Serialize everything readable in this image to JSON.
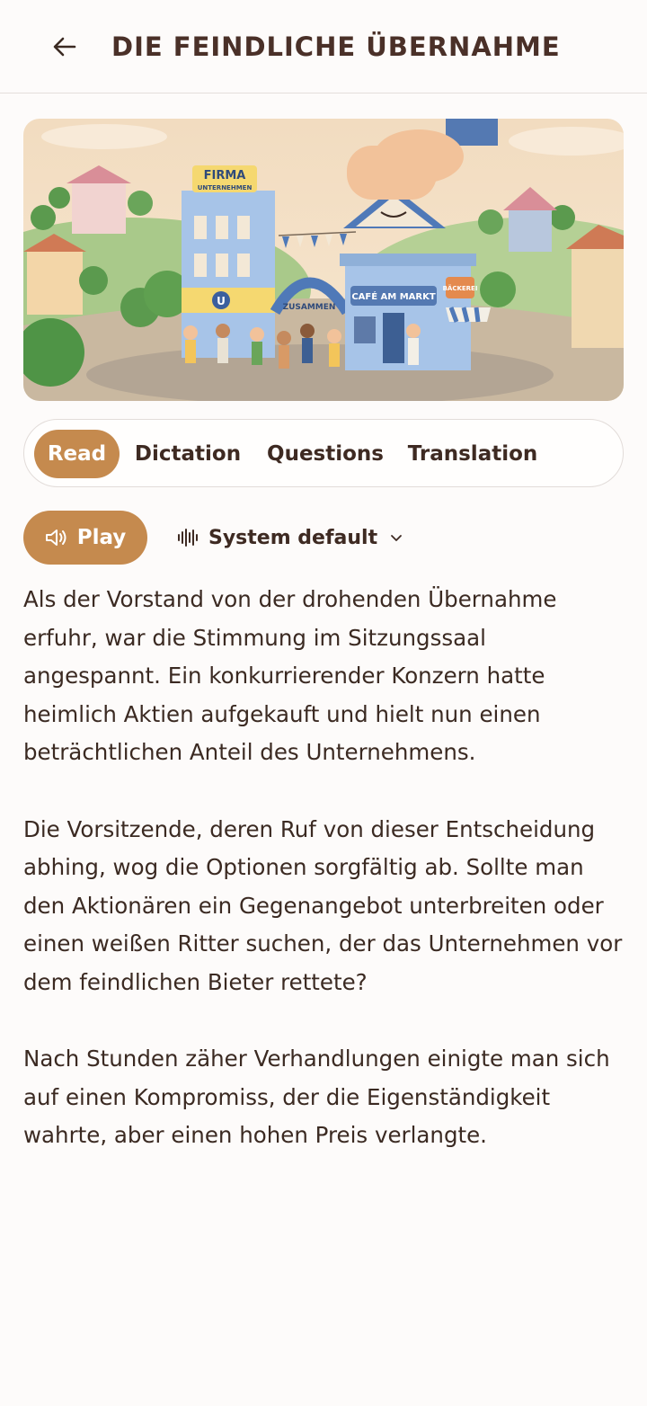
{
  "header": {
    "title": "DIE FEINDLICHE ÜBERNAHME",
    "back_icon": "arrow-left-icon"
  },
  "hero": {
    "sign_firma": "FIRMA",
    "sign_unternehmen": "UNTERNEHMEN",
    "sign_cafe": "CAFÉ AM MARKT",
    "sign_baeckerei": "BÄCKEREI",
    "sign_zusammen": "ZUSAMMEN",
    "door_letter": "U"
  },
  "tabs": [
    {
      "label": "Read",
      "active": true
    },
    {
      "label": "Dictation",
      "active": false
    },
    {
      "label": "Questions",
      "active": false
    },
    {
      "label": "Translation",
      "active": false
    }
  ],
  "controls": {
    "play_label": "Play",
    "play_icon": "speaker-icon",
    "voice_icon": "waveform-icon",
    "voice_label": "System default",
    "voice_chevron": "chevron-down-icon"
  },
  "story": {
    "paragraphs": [
      "Als der Vorstand von der drohenden Übernahme erfuhr, war die Stimmung im Sitzungssaal angespannt. Ein konkurrierender Konzern hatte heimlich Aktien aufgekauft und hielt nun einen beträchtlichen Anteil des Unternehmens.",
      "Die Vorsitzende, deren Ruf von dieser Entscheidung abhing, wog die Optionen sorgfältig ab. Sollte man den Aktionären ein Gegenangebot unterbreiten oder einen weißen Ritter suchen, der das Unternehmen vor dem feindlichen Bieter rettete?",
      "Nach Stunden zäher Verhandlungen einigte man sich auf einen Kompromiss, der die Eigenständigkeit wahrte, aber einen hohen Preis verlangte."
    ]
  },
  "colors": {
    "accent": "#c58a4e",
    "text": "#3b2a22",
    "background": "#fdfbfa"
  }
}
